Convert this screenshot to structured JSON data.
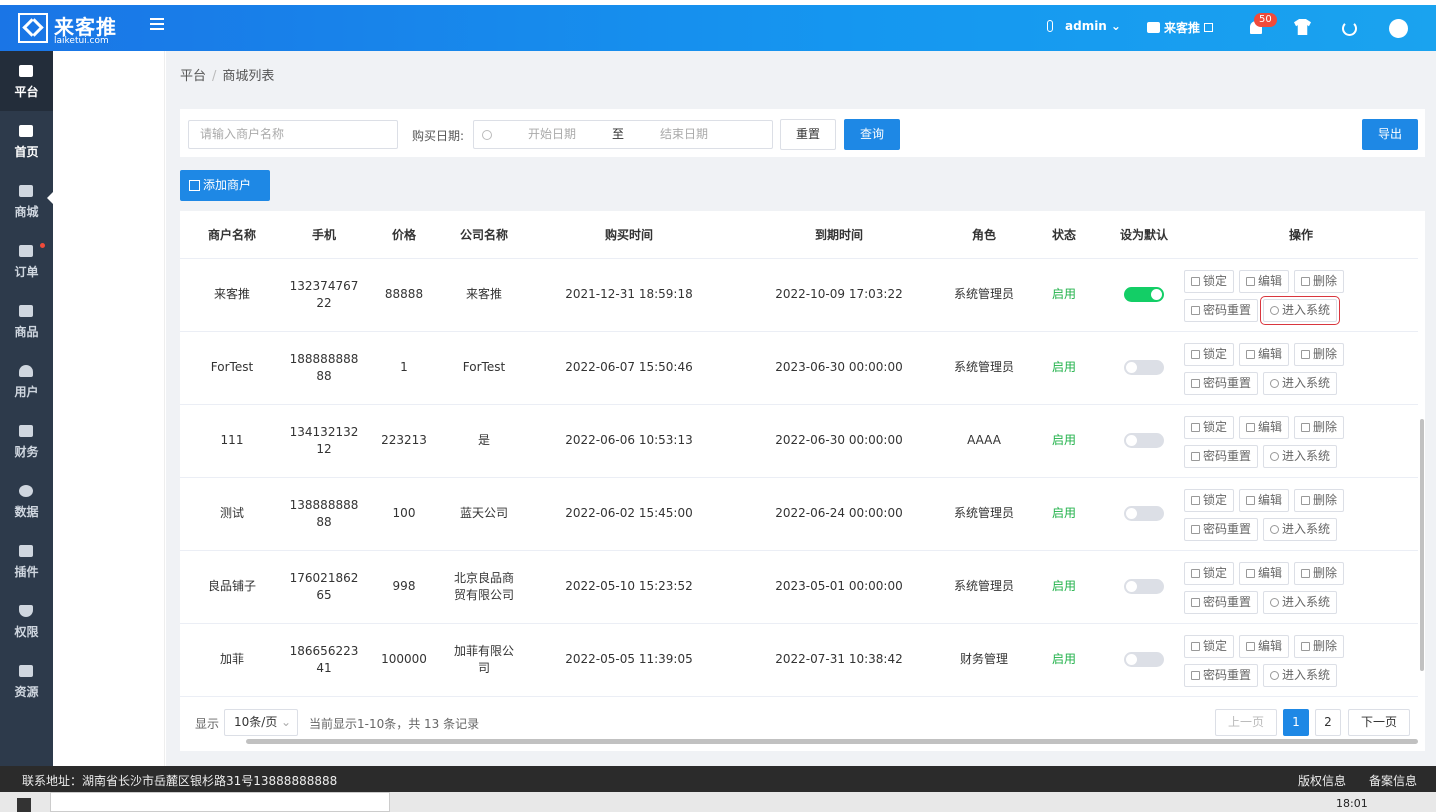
{
  "header": {
    "logo_title": "来客推",
    "logo_sub": "laiketui.com",
    "user": "admin",
    "shop": "来客推",
    "notifications": "50"
  },
  "sidebar": {
    "items": [
      {
        "label": "平台",
        "icon": "dollar-icon"
      },
      {
        "label": "首页",
        "icon": "home-icon"
      },
      {
        "label": "商城",
        "icon": "store-icon"
      },
      {
        "label": "订单",
        "icon": "order-icon"
      },
      {
        "label": "商品",
        "icon": "goods-icon"
      },
      {
        "label": "用户",
        "icon": "user-icon"
      },
      {
        "label": "财务",
        "icon": "wallet-icon"
      },
      {
        "label": "数据",
        "icon": "pie-icon"
      },
      {
        "label": "插件",
        "icon": "puzzle-icon"
      },
      {
        "label": "权限",
        "icon": "shield-icon"
      },
      {
        "label": "资源",
        "icon": "image-icon"
      }
    ]
  },
  "breadcrumb": {
    "root": "平台",
    "sep": "/",
    "current": "商城列表"
  },
  "filter": {
    "merchant_placeholder": "请输入商户名称",
    "date_label": "购买日期:",
    "start_placeholder": "开始日期",
    "to": "至",
    "end_placeholder": "结束日期",
    "reset": "重置",
    "query": "查询",
    "export": "导出"
  },
  "add_button": "添加商户",
  "table": {
    "headers": [
      "商户名称",
      "手机",
      "价格",
      "公司名称",
      "购买时间",
      "到期时间",
      "角色",
      "状态",
      "设为默认",
      "操作"
    ],
    "rows": [
      {
        "name": "来客推",
        "phone1": "132374767",
        "phone2": "22",
        "price": "88888",
        "company": "来客推",
        "company2": "",
        "buy": "2021-12-31 18:59:18",
        "expire": "2022-10-09 17:03:22",
        "role": "系统管理员",
        "status": "启用"
      },
      {
        "name": "ForTest",
        "phone1": "188888888",
        "phone2": "88",
        "price": "1",
        "company": "ForTest",
        "company2": "",
        "buy": "2022-06-07 15:50:46",
        "expire": "2023-06-30 00:00:00",
        "role": "系统管理员",
        "status": "启用"
      },
      {
        "name": "111",
        "phone1": "134132132",
        "phone2": "12",
        "price": "223213",
        "company": "是",
        "company2": "",
        "buy": "2022-06-06 10:53:13",
        "expire": "2022-06-30 00:00:00",
        "role": "AAAA",
        "status": "启用"
      },
      {
        "name": "测试",
        "phone1": "138888888",
        "phone2": "88",
        "price": "100",
        "company": "蓝天公司",
        "company2": "",
        "buy": "2022-06-02 15:45:00",
        "expire": "2022-06-24 00:00:00",
        "role": "系统管理员",
        "status": "启用"
      },
      {
        "name": "良品铺子",
        "phone1": "176021862",
        "phone2": "65",
        "price": "998",
        "company": "北京良品商",
        "company2": "贸有限公司",
        "buy": "2022-05-10 15:23:52",
        "expire": "2023-05-01 00:00:00",
        "role": "系统管理员",
        "status": "启用"
      },
      {
        "name": "加菲",
        "phone1": "186656223",
        "phone2": "41",
        "price": "100000",
        "company": "加菲有限公",
        "company2": "司",
        "buy": "2022-05-05 11:39:05",
        "expire": "2022-07-31 10:38:42",
        "role": "财务管理",
        "status": "启用"
      }
    ],
    "ops": {
      "lock": "锁定",
      "edit": "编辑",
      "delete": "删除",
      "reset_pwd": "密码重置",
      "enter": "进入系统"
    }
  },
  "pagination": {
    "show": "显示",
    "per_page": "10条/页",
    "summary": "当前显示1-10条，共 13 条记录",
    "prev": "上一页",
    "page1": "1",
    "page2": "2",
    "next": "下一页"
  },
  "footer": {
    "address": "联系地址：湖南省长沙市岳麓区银杉路31号13888888888",
    "copyright": "版权信息",
    "icp": "备案信息"
  },
  "taskbar": {
    "time": "18:01"
  },
  "colors": {
    "primary": "#1e88e5",
    "sidebar": "#2d3a4b",
    "success": "#21b24a",
    "danger": "#f04a3a"
  }
}
